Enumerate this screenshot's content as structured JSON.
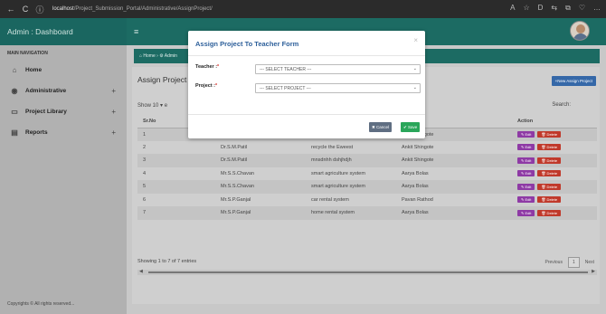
{
  "browser": {
    "back_icon": "←",
    "reload_icon": "C",
    "url_host": "localhost",
    "url_path": "/Project_Submission_Portal/Administrative/AssignProject/",
    "right_icons": [
      "A",
      "☆",
      "D",
      "⇆",
      "⧉",
      "♡",
      "…"
    ]
  },
  "header": {
    "title": "Admin : Dashboard",
    "menu_icon": "≡"
  },
  "sidebar": {
    "heading": "MAIN NAVIGATION",
    "items": [
      {
        "label": "Home",
        "icon": "⌂",
        "expandable": false
      },
      {
        "label": "Administrative",
        "icon": "◉",
        "expandable": true
      },
      {
        "label": "Project Library",
        "icon": "▭",
        "expandable": true
      },
      {
        "label": "Reports",
        "icon": "▤",
        "expandable": true
      }
    ],
    "plus": "+",
    "footer": "Copyrights © All rights reserved..."
  },
  "content": {
    "breadcrumb": "⌂ Home  ›  ⚙ Admin",
    "title": "Assign Project",
    "new_button": "+New Assign Project",
    "show_label": "Show  10    ▾ e",
    "search_label": "Search:",
    "columns": [
      "Sr.No",
      "",
      "",
      "r",
      "Action"
    ],
    "rows": [
      {
        "sr": "1",
        "teacher": "",
        "project": "",
        "student": "Ankit Shingote"
      },
      {
        "sr": "2",
        "teacher": "Dr.S.M.Patil",
        "project": "recycle the Eweest",
        "student": "Ankit Shingote"
      },
      {
        "sr": "3",
        "teacher": "Dr.S.M.Patil",
        "project": "mnsdnhh dshjhdjh",
        "student": "Ankit Shingote"
      },
      {
        "sr": "4",
        "teacher": "Mr.S.S.Chavan",
        "project": "smart agriculture system",
        "student": "Aarya Bolas"
      },
      {
        "sr": "5",
        "teacher": "Mr.S.S.Chavan",
        "project": "smart agriculture system",
        "student": "Aarya Bolas"
      },
      {
        "sr": "6",
        "teacher": "Mr.S.P.Ganjal",
        "project": "car rental system",
        "student": "Pavan Rathod"
      },
      {
        "sr": "7",
        "teacher": "Mr.S.P.Ganjal",
        "project": "home rental system",
        "student": "Aarya Bolas"
      }
    ],
    "edit_label": "✎ Edit",
    "delete_label": "🗑 Delete",
    "showing": "Showing 1 to 7 of 7 entries",
    "pager": {
      "prev": "Previous",
      "current": "1",
      "next": "Next"
    }
  },
  "modal": {
    "title": "Assign Project To Teacher Form",
    "close": "×",
    "teacher_label": "Teacher :",
    "project_label": "Project :",
    "required_mark": "*",
    "teacher_select": "--- SELECT TEACHER ---",
    "project_select": "--- SELECT PROJECT ---",
    "cancel": "✖ Cancel",
    "save": "✔ Save"
  },
  "colors": {
    "header": "#1c6b63",
    "modal_title": "#2d5f9a",
    "edit": "#8e3aa5",
    "delete": "#c0392b",
    "save": "#2aa65a",
    "cancel": "#5f6e82",
    "new_button": "#3568a8"
  }
}
